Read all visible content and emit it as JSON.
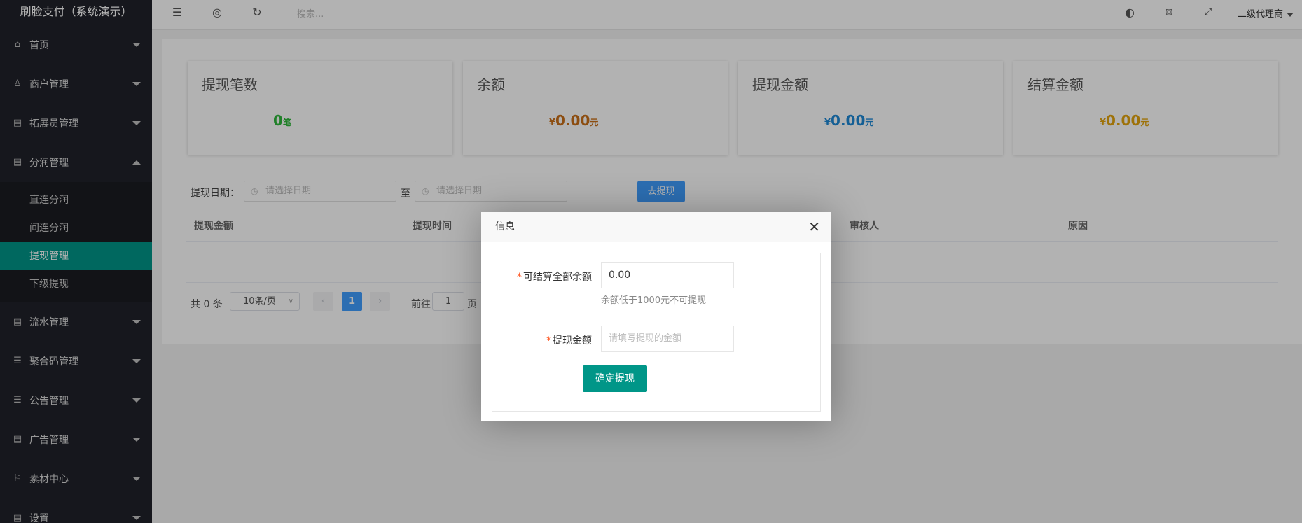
{
  "app": {
    "title": "刷脸支付（系统演示）"
  },
  "sidebar": {
    "items": [
      {
        "label": "首页",
        "icon": "home-icon"
      },
      {
        "label": "商户管理",
        "icon": "user-icon"
      },
      {
        "label": "拓展员管理",
        "icon": "clipboard-icon"
      },
      {
        "label": "分润管理",
        "icon": "clipboard-icon",
        "expanded": true,
        "children": [
          {
            "label": "直连分润"
          },
          {
            "label": "间连分润"
          },
          {
            "label": "提现管理",
            "active": true
          },
          {
            "label": "下级提现"
          }
        ]
      },
      {
        "label": "流水管理",
        "icon": "clipboard-icon"
      },
      {
        "label": "聚合码管理",
        "icon": "list-icon"
      },
      {
        "label": "公告管理",
        "icon": "list-icon"
      },
      {
        "label": "广告管理",
        "icon": "clipboard-icon"
      },
      {
        "label": "素材中心",
        "icon": "flag-icon"
      },
      {
        "label": "设置",
        "icon": "clipboard-icon"
      }
    ]
  },
  "header": {
    "search_placeholder": "搜索...",
    "user": "二级代理商"
  },
  "stats": [
    {
      "title": "提现笔数",
      "value": "0",
      "unit": "笔",
      "color": "#2fb83b"
    },
    {
      "title": "余额",
      "prefix": "¥",
      "value": "0.00",
      "unit": "元",
      "color": "#c96f18"
    },
    {
      "title": "提现金额",
      "prefix": "¥",
      "value": "0.00",
      "unit": "元",
      "color": "#1e88d6"
    },
    {
      "title": "结算金额",
      "prefix": "¥",
      "value": "0.00",
      "unit": "元",
      "color": "#e2a40d"
    }
  ],
  "filter": {
    "label": "提现日期：",
    "start_placeholder": "请选择日期",
    "to": "至",
    "end_placeholder": "请选择日期",
    "button": "去提现"
  },
  "table": {
    "columns": [
      "提现金额",
      "提现时间",
      "审核人",
      "原因"
    ]
  },
  "pagination": {
    "total": "共 0 条",
    "page_size": "10条/页",
    "current": "1",
    "goto_label": "前往",
    "goto_value": "1",
    "goto_suffix": "页"
  },
  "modal": {
    "title": "信息",
    "balance_label": "可结算全部余额",
    "balance_value": "0.00",
    "hint": "余额低于1000元不可提现",
    "amount_label": "提现金额",
    "amount_placeholder": "请填写提现的金额",
    "submit": "确定提现"
  }
}
